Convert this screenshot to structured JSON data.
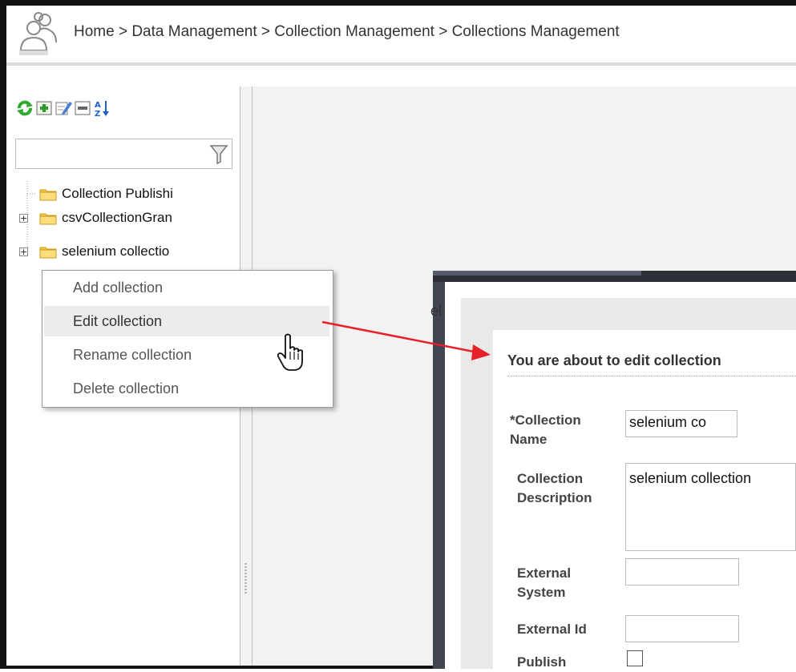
{
  "header": {
    "breadcrumb": "Home > Data Management > Collection Management > Collections Management",
    "logo_icon": "users-icon"
  },
  "toolbar": {
    "icons": [
      "refresh-icon",
      "add-icon",
      "edit-icon",
      "remove-icon",
      "sort-az-icon"
    ]
  },
  "filter": {
    "value": "",
    "icon": "filter-funnel-icon"
  },
  "tree": {
    "items": [
      {
        "label": "Collection Publishi",
        "expandable": false
      },
      {
        "label": "csvCollectionGran",
        "expandable": true
      },
      {
        "label": "selenium collectio",
        "expandable": true
      }
    ]
  },
  "context_menu": {
    "items": [
      {
        "label": "Add collection",
        "highlighted": false
      },
      {
        "label": "Edit collection",
        "highlighted": true
      },
      {
        "label": "Rename collection",
        "highlighted": false
      },
      {
        "label": "Delete collection",
        "highlighted": false
      }
    ]
  },
  "dialog": {
    "side_text": "el",
    "title": "You are about to edit collection",
    "fields": {
      "name_label_line1": "*Collection",
      "name_label_line2": "Name",
      "name_value": "selenium co",
      "desc_label_line1": "Collection",
      "desc_label_line2": "Description",
      "desc_value": "selenium collection",
      "ext_sys_label_line1": "External",
      "ext_sys_label_line2": "System",
      "ext_sys_value": "",
      "ext_id_label": "External Id",
      "ext_id_value": "",
      "publish_label": "Publish",
      "publish_checked": false
    }
  },
  "colors": {
    "arrow": "#e8202a",
    "dialog_frame": "#414551",
    "menu_highlight": "#ececec"
  }
}
